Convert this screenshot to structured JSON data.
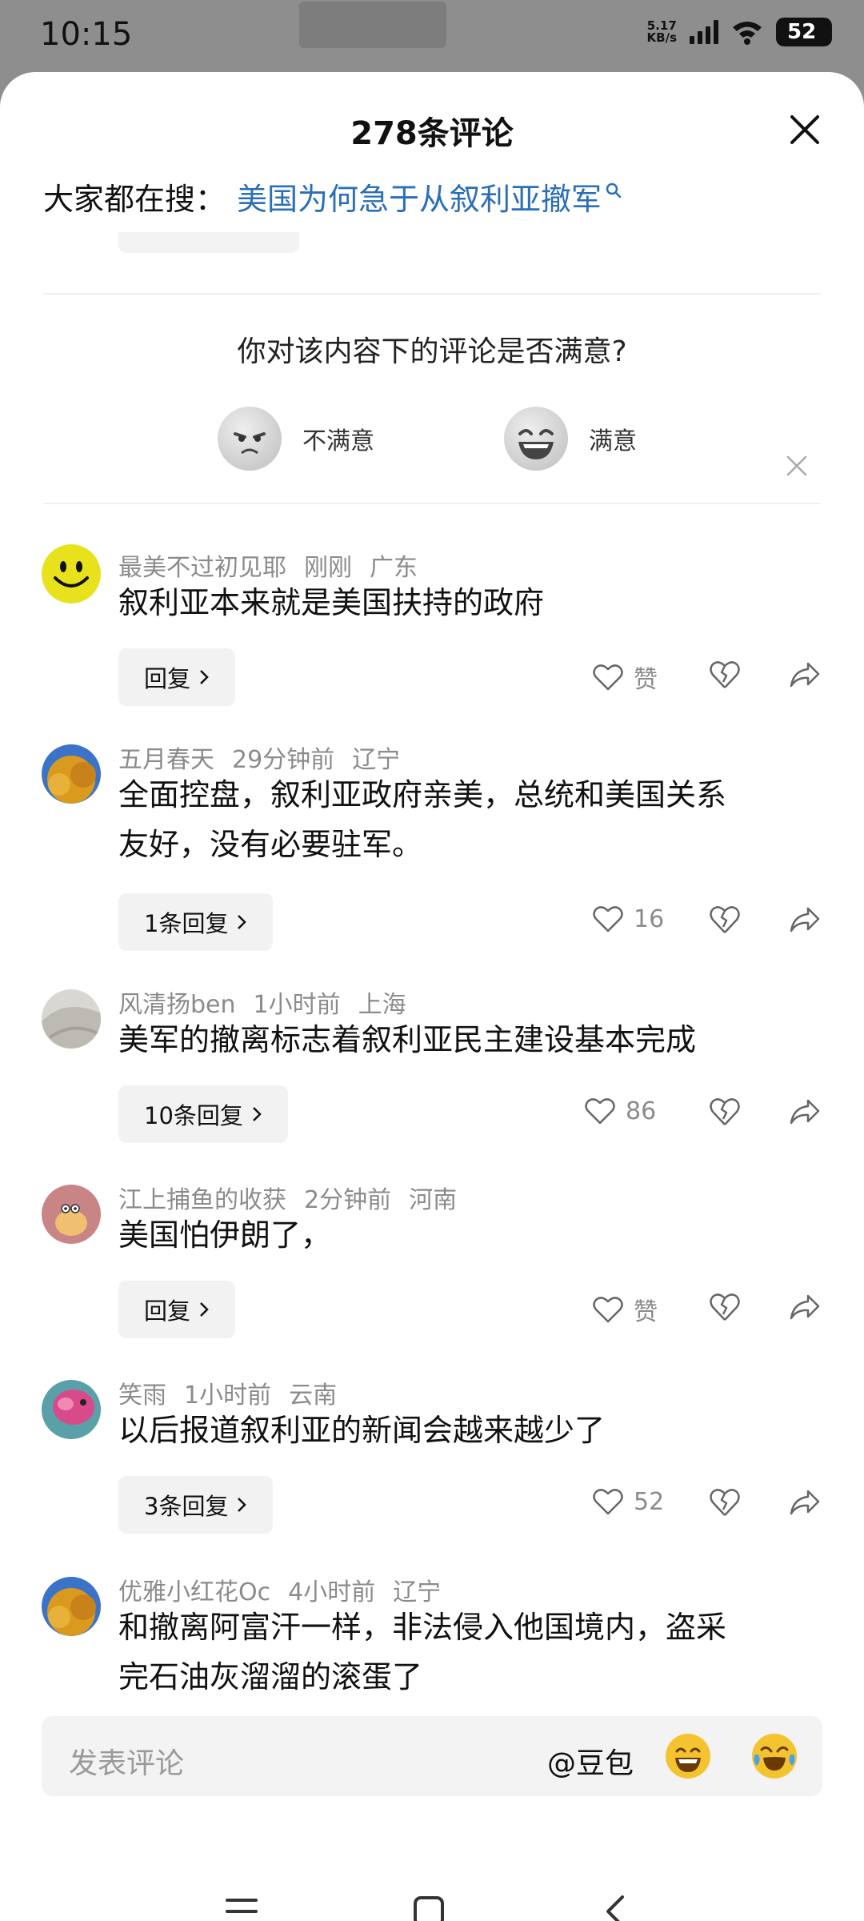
{
  "status_bar": {
    "time": "10:15",
    "net_speed_value": "5.17",
    "net_speed_unit": "KB/s",
    "battery": "52"
  },
  "sheet": {
    "title": "278条评论",
    "hot_search_prefix": "大家都在搜：",
    "hot_search_link": "美国为何急于从叙利亚撤军",
    "accent_color": "#2a6fb8"
  },
  "survey": {
    "question": "你对该内容下的评论是否满意?",
    "options": [
      {
        "label": "不满意",
        "icon": "frown-face-icon"
      },
      {
        "label": "满意",
        "icon": "laughing-face-icon"
      }
    ]
  },
  "comments": [
    {
      "user": "最美不过初见耶",
      "time": "刚刚",
      "location": "广东",
      "lines": [
        "叙利亚本来就是美国扶持的政府"
      ],
      "reply_label": "回复",
      "likes": "赞",
      "avatar": "smiley-avatar"
    },
    {
      "user": "五月春天",
      "time": "29分钟前",
      "location": "辽宁",
      "lines": [
        "全面控盘，叙利亚政府亲美，总统和美国关系",
        "友好，没有必要驻军。"
      ],
      "reply_label": "1条回复",
      "likes": "16",
      "avatar": "autumn-tree-avatar"
    },
    {
      "user": "风清扬ben",
      "time": "1小时前",
      "location": "上海",
      "lines": [
        "美军的撤离标志着叙利亚民主建设基本完成"
      ],
      "reply_label": "10条回复",
      "likes": "86",
      "avatar": "fabric-avatar"
    },
    {
      "user": "江上捕鱼的收获",
      "time": "2分钟前",
      "location": "河南",
      "lines": [
        "美国怕伊朗了，"
      ],
      "reply_label": "回复",
      "likes": "赞",
      "avatar": "cartoon-bun-avatar"
    },
    {
      "user": "笑雨",
      "time": "1小时前",
      "location": "云南",
      "lines": [
        "以后报道叙利亚的新闻会越来越少了"
      ],
      "reply_label": "3条回复",
      "likes": "52",
      "avatar": "fish-avatar"
    },
    {
      "user": "优雅小红花Oc",
      "time": "4小时前",
      "location": "辽宁",
      "lines": [
        "和撤离阿富汗一样，非法侵入他国境内，盗采",
        "完石油灰溜溜的滚蛋了"
      ],
      "reply_label": "",
      "likes": "",
      "avatar": "autumn-tree-avatar"
    }
  ],
  "input_bar": {
    "placeholder": "发表评论",
    "at_bot": "@豆包",
    "emoji_buttons": [
      "grin-emoji-icon",
      "laugh-cry-emoji-icon"
    ]
  },
  "nav_bar": {
    "buttons": [
      "menu-icon",
      "home-icon",
      "back-icon"
    ]
  }
}
